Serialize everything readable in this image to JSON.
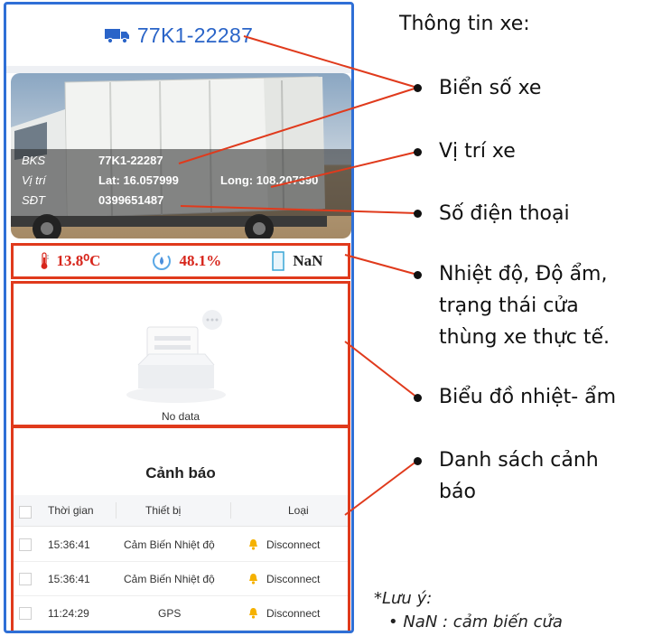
{
  "app": {
    "plate_header": "77K1-22287"
  },
  "vehicle_info": {
    "bks_label": "BKS",
    "bks_value": "77K1-22287",
    "vitri_label": "Vị trí",
    "lat_value": "Lat: 16.057999",
    "long_value": "Long: 108.207390",
    "sdt_label": "SĐT",
    "sdt_value": "0399651487"
  },
  "sensors": {
    "temperature": "13.8⁰C",
    "humidity": "48.1%",
    "door": "NaN"
  },
  "chart": {
    "empty_text": "No data"
  },
  "alerts": {
    "title": "Cảnh báo",
    "columns": [
      "Thời gian",
      "Thiết bị",
      "Loại"
    ],
    "rows": [
      {
        "time": "15:36:41",
        "device": "Cảm Biến Nhiệt độ",
        "type": "Disconnect"
      },
      {
        "time": "15:36:41",
        "device": "Cảm Biến Nhiệt độ",
        "type": "Disconnect"
      },
      {
        "time": "11:24:29",
        "device": "GPS",
        "type": "Disconnect"
      }
    ]
  },
  "annotations": {
    "heading": "Thông tin xe:",
    "plate": "Biển số xe",
    "location": "Vị trí xe",
    "phone": "Số điện thoại",
    "sensors_line1": "Nhiệt độ, Độ ẩm,",
    "sensors_line2": "trạng thái cửa",
    "sensors_line3": "thùng xe thực tế.",
    "chart": "Biểu đồ nhiệt- ẩm",
    "alerts_line1": "Danh sách cảnh",
    "alerts_line2": "báo",
    "note": "*Lưu ý:",
    "note_item": "• NaN : cảm biến cửa"
  },
  "colors": {
    "frame": "#2f6fd6",
    "highlight": "#e03a1c",
    "plate_text": "#2a64c8",
    "sensor_value": "#d7261c",
    "bell": "#f5b100"
  },
  "icons": [
    "truck-icon",
    "thermometer-icon",
    "humidity-icon",
    "door-icon",
    "empty-data-icon",
    "bell-icon"
  ]
}
